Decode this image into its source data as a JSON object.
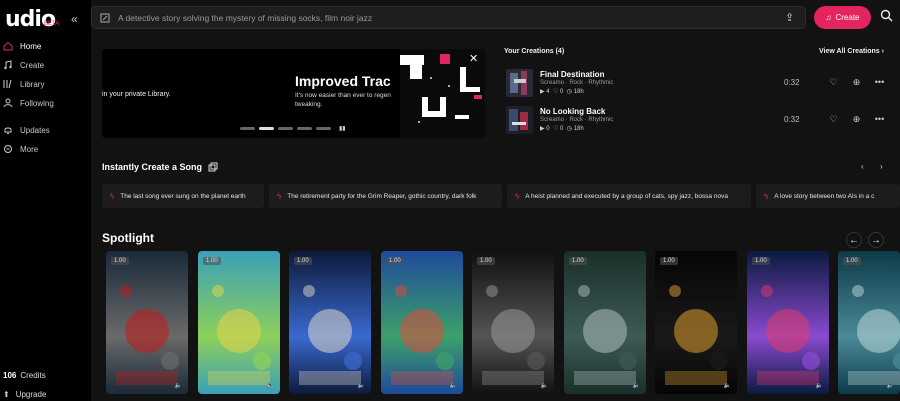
{
  "app": {
    "logo": "udio",
    "beta": "BETA"
  },
  "sidebar": {
    "items": [
      {
        "label": "Home"
      },
      {
        "label": "Create"
      },
      {
        "label": "Library"
      },
      {
        "label": "Following"
      },
      {
        "label": "Updates"
      },
      {
        "label": "More"
      }
    ],
    "credits_value": "106",
    "credits_label": "Credits",
    "upgrade_label": "Upgrade"
  },
  "header": {
    "search_placeholder": "A detective story solving the mystery of missing socks, film noir jazz",
    "create_label": "Create"
  },
  "banner": {
    "tail_text": "in your private Library.",
    "title": "Improved Trac",
    "subtitle": "It's now easier than ever to regen tweaking."
  },
  "creations": {
    "heading": "Your Creations (4)",
    "view_all": "View All Creations",
    "songs": [
      {
        "name": "Final Destination",
        "tags": "Screamo  ·  Rock  ·  Rhythmic",
        "plays": "4",
        "likes": "0",
        "age": "18h",
        "duration": "0:32"
      },
      {
        "name": "No Looking Back",
        "tags": "Screamo  ·  Rock  ·  Rhythmic",
        "plays": "0",
        "likes": "0",
        "age": "18h",
        "duration": "0:32"
      }
    ]
  },
  "instant": {
    "heading": "Instantly Create a Song",
    "prompts": [
      "The last song ever sung on the planet earth",
      "The retirement party for the Grim Reaper, gothic country, dark folk",
      "A heist planned and executed by a group of cats, spy jazz, bossa nova",
      "A love story between two AIs in a c"
    ]
  },
  "spotlight": {
    "heading": "Spotlight",
    "badge": "1.00",
    "cards": [
      {
        "theme": "red-car-space",
        "c1": "#1a2a3a",
        "c2": "#6a6a6a",
        "c3": "#c51a1a"
      },
      {
        "theme": "green-face-flowers",
        "c1": "#3aa0b8",
        "c2": "#8ed05a",
        "c3": "#e7d34a"
      },
      {
        "theme": "cosmic-beach",
        "c1": "#0d1a3a",
        "c2": "#3a6ad0",
        "c3": "#e0d8c8"
      },
      {
        "theme": "alien-planets",
        "c1": "#1e4a9a",
        "c2": "#3da06a",
        "c3": "#e24a3a"
      },
      {
        "theme": "bw-car-interior",
        "c1": "#111111",
        "c2": "#555555",
        "c3": "#999999"
      },
      {
        "theme": "night-city-car",
        "c1": "#1a2f2a",
        "c2": "#3e5a55",
        "c3": "#b0c0c0"
      },
      {
        "theme": "glitch-lines",
        "c1": "#050505",
        "c2": "#1a1a1a",
        "c3": "#e0a030"
      },
      {
        "theme": "ufo-flowers",
        "c1": "#0a1a40",
        "c2": "#8a4ad0",
        "c3": "#e23a6a"
      },
      {
        "theme": "teal-landscape",
        "c1": "#0e3a48",
        "c2": "#4a8a9a",
        "c3": "#c0d8d8"
      }
    ]
  },
  "colors": {
    "accent": "#e3245f",
    "bg": "#121212",
    "sidebar": "#000000"
  }
}
